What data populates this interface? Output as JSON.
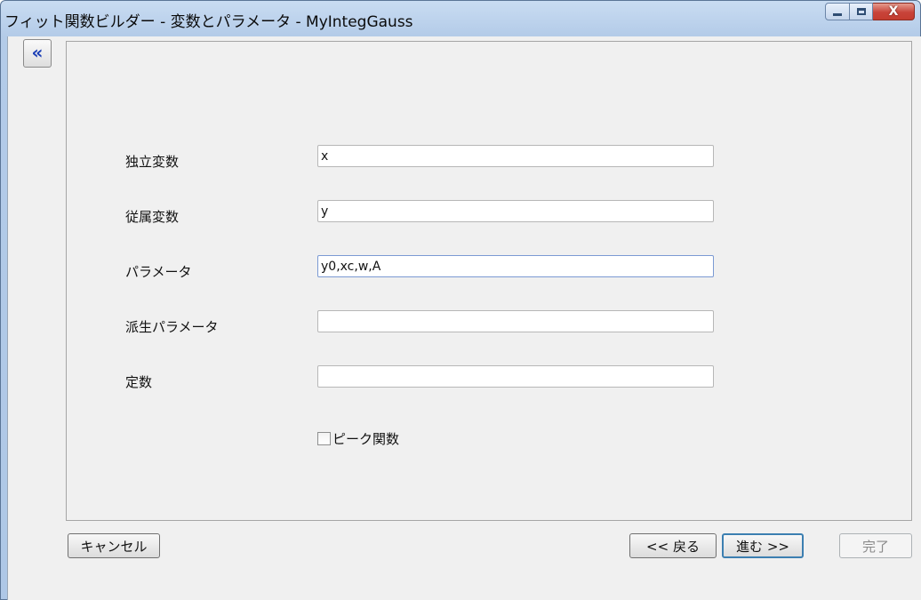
{
  "window": {
    "title": "フィット関数ビルダー - 変数とパラメータ - MyIntegGauss",
    "controls": {
      "minimize": "minimize-icon",
      "maximize": "maximize-icon",
      "close": "close-icon"
    }
  },
  "sidebar_toggle": {
    "label": "«"
  },
  "form": {
    "independent_label": "独立変数",
    "independent_value": "x",
    "dependent_label": "従属変数",
    "dependent_value": "y",
    "parameters_label": "パラメータ",
    "parameters_value": "y0,xc,w,A",
    "derived_label": "派生パラメータ",
    "derived_value": "",
    "constants_label": "定数",
    "constants_value": "",
    "peak_checkbox_label": "ピーク関数",
    "peak_checked": false
  },
  "buttons": {
    "cancel": "キャンセル",
    "back": "<< 戻る",
    "next": "進む >>",
    "finish": "完了"
  }
}
